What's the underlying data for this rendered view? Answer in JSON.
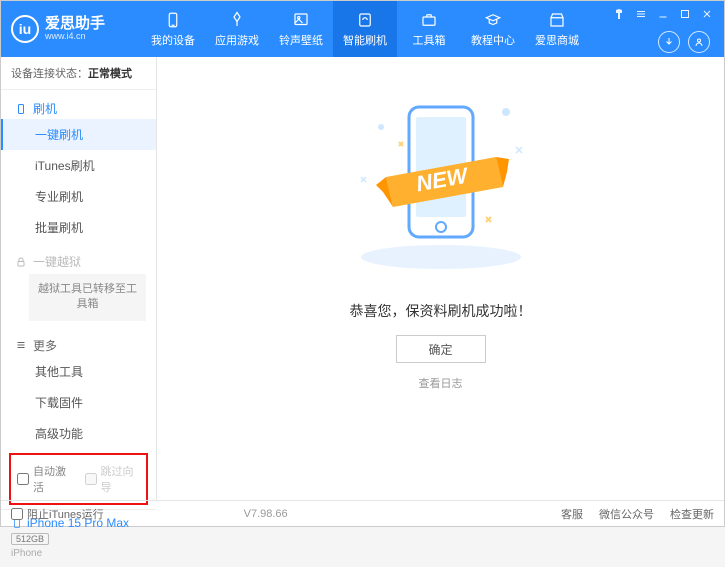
{
  "app": {
    "title": "爱思助手",
    "subtitle": "www.i4.cn"
  },
  "nav": {
    "items": [
      "我的设备",
      "应用游戏",
      "铃声壁纸",
      "智能刷机",
      "工具箱",
      "教程中心",
      "爱思商城"
    ],
    "active_index": 3
  },
  "sidebar": {
    "status_label": "设备连接状态：",
    "status_value": "正常模式",
    "section_flash": "刷机",
    "flash_items": [
      "一键刷机",
      "iTunes刷机",
      "专业刷机",
      "批量刷机"
    ],
    "flash_active_index": 0,
    "section_jailbreak": "一键越狱",
    "jailbreak_note": "越狱工具已转移至工具箱",
    "section_more": "更多",
    "more_items": [
      "其他工具",
      "下载固件",
      "高级功能"
    ],
    "checkboxes": {
      "auto_activate": "自动激活",
      "skip_setup": "跳过向导"
    },
    "device": {
      "name": "iPhone 15 Pro Max",
      "storage": "512GB",
      "type": "iPhone"
    }
  },
  "main": {
    "new_badge": "NEW",
    "success_msg": "恭喜您，保资料刷机成功啦！",
    "ok_button": "确定",
    "view_log": "查看日志"
  },
  "footer": {
    "block_itunes": "阻止iTunes运行",
    "version": "V7.98.66",
    "links": [
      "客服",
      "微信公众号",
      "检查更新"
    ]
  }
}
